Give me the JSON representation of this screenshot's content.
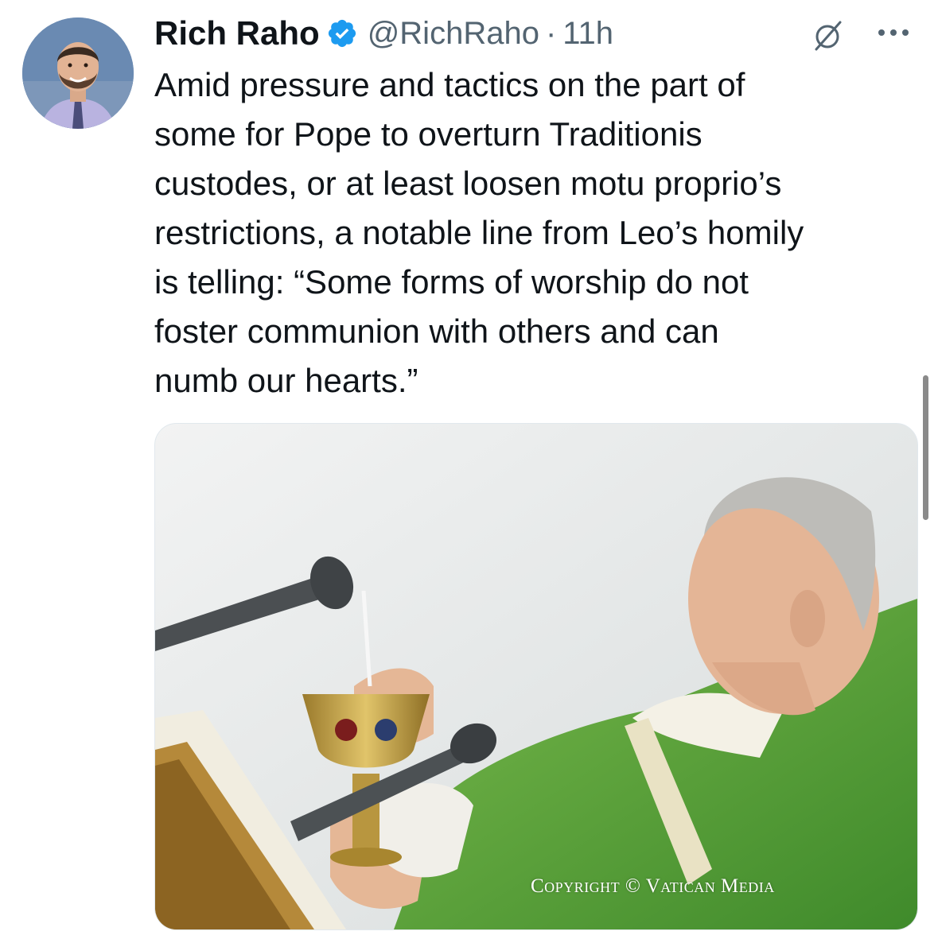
{
  "tweet": {
    "author_name": "Rich Raho",
    "handle": "@RichRaho",
    "separator": "·",
    "time": "11h",
    "text": "Amid pressure and tactics on the part of\nsome for Pope to overturn Traditionis\ncustodes, or at least loosen motu proprio’s\nrestrictions, a notable line from Leo’s homily\nis telling: “Some forms of worship do not\nfoster communion with others and can\nnumb our hearts.”",
    "media": {
      "watermark": "Copyright © Vatican Media"
    }
  },
  "icons": {
    "verified": "verified-badge-icon",
    "grok": "grok-icon",
    "more": "more-options-icon"
  },
  "colors": {
    "text": "#0f1419",
    "secondary": "#536471",
    "verified": "#1d9bf0"
  }
}
